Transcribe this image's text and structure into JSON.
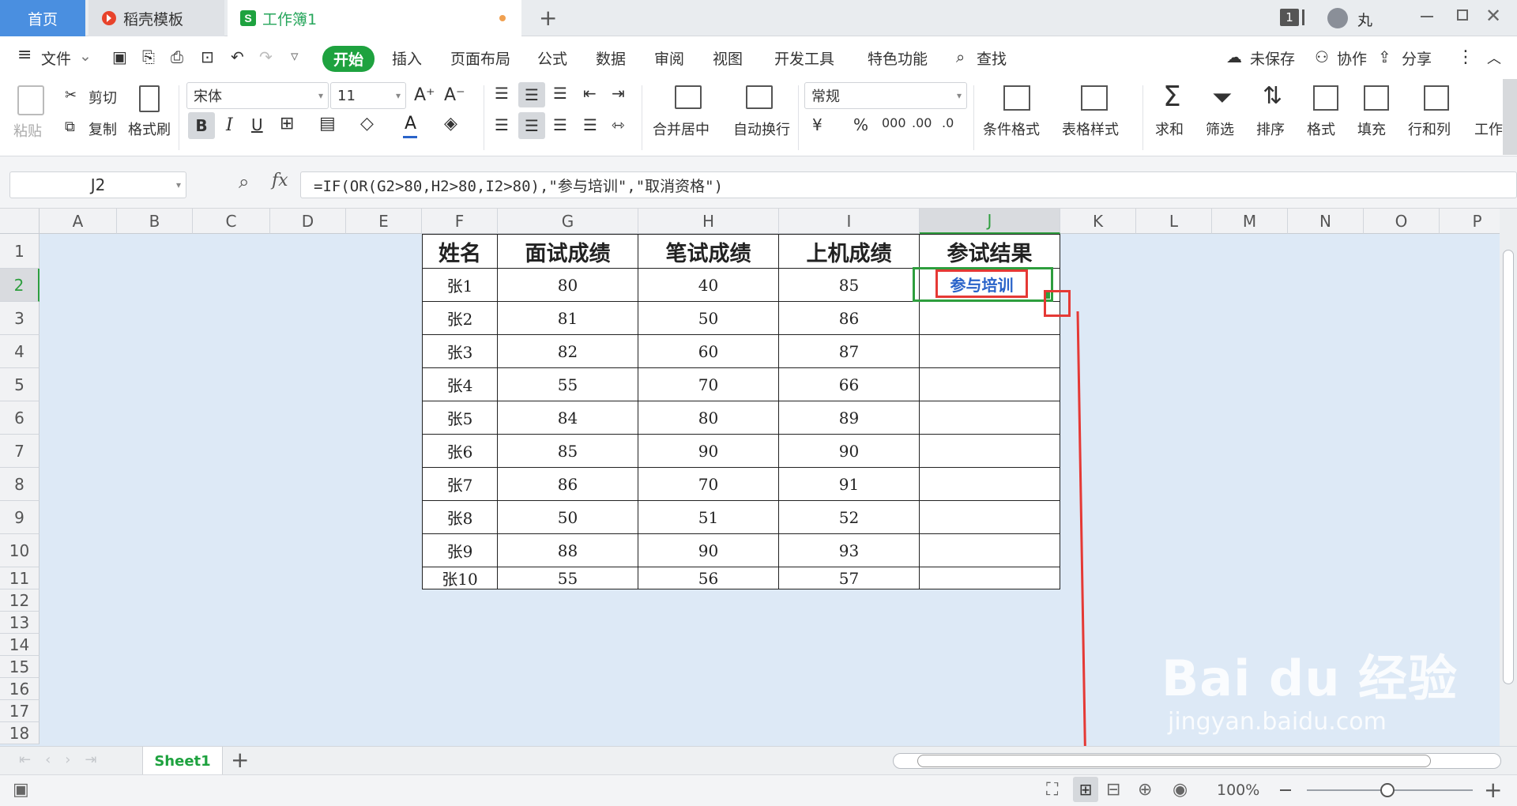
{
  "tabs": [
    {
      "label": "首页"
    },
    {
      "label": "稻壳模板"
    },
    {
      "label": "工作簿1"
    }
  ],
  "window": {
    "badge": "1",
    "user": "丸"
  },
  "menu": {
    "file": "文件",
    "items": [
      "开始",
      "插入",
      "页面布局",
      "公式",
      "数据",
      "审阅",
      "视图",
      "开发工具",
      "特色功能"
    ],
    "search": "查找",
    "unsaved": "未保存",
    "collab": "协作",
    "share": "分享"
  },
  "ribbon": {
    "paste": "粘贴",
    "cut": "剪切",
    "copy": "复制",
    "format_painter": "格式刷",
    "font": "宋体",
    "size": "11",
    "number_format": "常规",
    "merge": "合并居中",
    "wrap": "自动换行",
    "cond_format": "条件格式",
    "table_style": "表格样式",
    "sum": "求和",
    "filter": "筛选",
    "sort": "排序",
    "format": "格式",
    "fill": "填充",
    "rowcol": "行和列",
    "worksheet": "工作"
  },
  "formula_bar": {
    "name_box": "J2",
    "fx": "fx",
    "formula": "=IF(OR(G2>80,H2>80,I2>80),\"参与培训\",\"取消资格\")"
  },
  "columns": [
    "A",
    "B",
    "C",
    "D",
    "E",
    "F",
    "G",
    "H",
    "I",
    "J",
    "K",
    "L",
    "M",
    "N",
    "O",
    "P"
  ],
  "rows": [
    "1",
    "2",
    "3",
    "4",
    "5",
    "6",
    "7",
    "8",
    "9",
    "10",
    "11",
    "12",
    "13",
    "14",
    "15",
    "16",
    "17",
    "18"
  ],
  "table": {
    "headers": [
      "姓名",
      "面试成绩",
      "笔试成绩",
      "上机成绩",
      "参试结果"
    ],
    "rows": [
      [
        "张1",
        "80",
        "40",
        "85",
        "参与培训"
      ],
      [
        "张2",
        "81",
        "50",
        "86",
        ""
      ],
      [
        "张3",
        "82",
        "60",
        "87",
        ""
      ],
      [
        "张4",
        "55",
        "70",
        "66",
        ""
      ],
      [
        "张5",
        "84",
        "80",
        "89",
        ""
      ],
      [
        "张6",
        "85",
        "90",
        "90",
        ""
      ],
      [
        "张7",
        "86",
        "70",
        "91",
        ""
      ],
      [
        "张8",
        "50",
        "51",
        "52",
        ""
      ],
      [
        "张9",
        "88",
        "90",
        "93",
        ""
      ],
      [
        "张10",
        "55",
        "56",
        "57",
        ""
      ]
    ]
  },
  "sheet_tabs": [
    {
      "label": "Sheet1"
    }
  ],
  "status": {
    "zoom": "100%"
  },
  "watermark": {
    "brand": "Bai du 经验",
    "url": "jingyan.baidu.com"
  },
  "colors": {
    "green": "#1ea23f",
    "selection": "#2e9e3e",
    "annotation": "#e53935",
    "sheet_bg": "#dde9f6"
  }
}
